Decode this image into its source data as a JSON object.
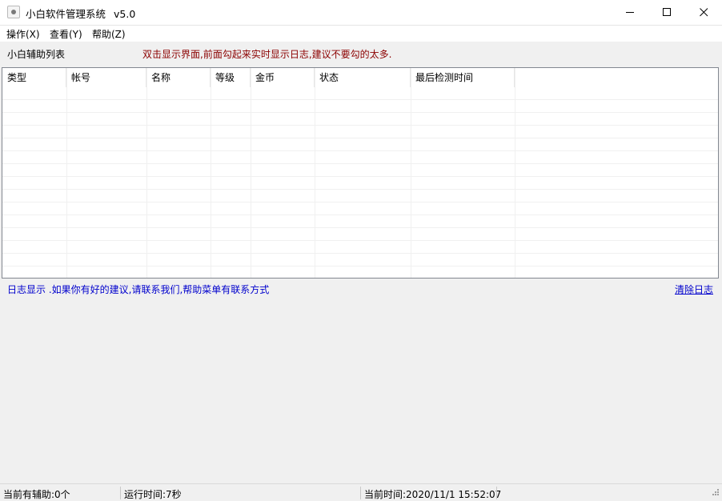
{
  "window": {
    "title": "小白软件管理系统",
    "version": "v5.0",
    "icons": {
      "app": "app-icon",
      "minimize": "minimize-icon",
      "maximize": "maximize-icon",
      "close": "close-icon"
    }
  },
  "menu": {
    "items": [
      {
        "label": "操作(X)"
      },
      {
        "label": "查看(Y)"
      },
      {
        "label": "帮助(Z)"
      }
    ]
  },
  "list": {
    "label": "小白辅助列表",
    "hint": "双击显示界面,前面勾起来实时显示日志,建议不要勾的太多.",
    "hint_color": "#8b0000",
    "columns": [
      "类型",
      "帐号",
      "名称",
      "等级",
      "金币",
      "状态",
      "最后检测时间"
    ],
    "rows": []
  },
  "log": {
    "title": "日志显示  .如果你有好的建议,请联系我们,帮助菜单有联系方式",
    "clear_label": "清除日志",
    "link_color": "#0000cd",
    "entries": []
  },
  "statusbar": {
    "assistants": "当前有辅助:0个",
    "runtime": "运行时间:7秒",
    "current_time": "当前时间:2020/11/1 15:52:07"
  }
}
